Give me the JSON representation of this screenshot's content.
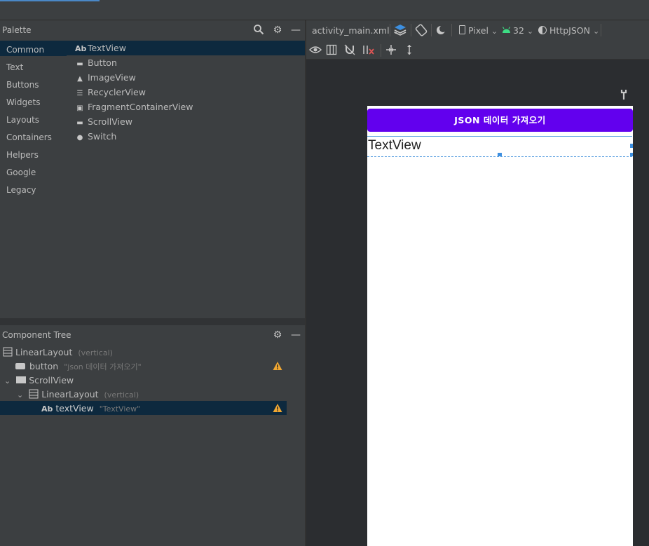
{
  "palette": {
    "title": "Palette",
    "categories": [
      "Common",
      "Text",
      "Buttons",
      "Widgets",
      "Layouts",
      "Containers",
      "Helpers",
      "Google",
      "Legacy"
    ],
    "items": [
      {
        "icon": "Ab",
        "label": "TextView"
      },
      {
        "icon": "▬",
        "label": "Button"
      },
      {
        "icon": "▲",
        "label": "ImageView"
      },
      {
        "icon": "☰",
        "label": "RecyclerView"
      },
      {
        "icon": "▣",
        "label": "FragmentContainerView"
      },
      {
        "icon": "▬",
        "label": "ScrollView"
      },
      {
        "icon": "●",
        "label": "Switch"
      }
    ]
  },
  "tree": {
    "title": "Component Tree",
    "rows": [
      {
        "name": "LinearLayout",
        "sub": "(vertical)"
      },
      {
        "name": "button",
        "sub": "\"json 데이터 가져오기\""
      },
      {
        "name": "ScrollView",
        "sub": ""
      },
      {
        "name": "LinearLayout",
        "sub": "(vertical)"
      },
      {
        "name": "textView",
        "sub": "\"TextView\""
      }
    ]
  },
  "toolbar": {
    "file": "activity_main.xml",
    "device": "Pixel",
    "api": "32",
    "theme": "HttpJSON"
  },
  "preview": {
    "button_label": "JSON 데이터 가져오기",
    "textview_label": "TextView"
  },
  "colors": {
    "accent": "#6200ee",
    "selection": "#0d293e",
    "warning": "#f0a732"
  }
}
